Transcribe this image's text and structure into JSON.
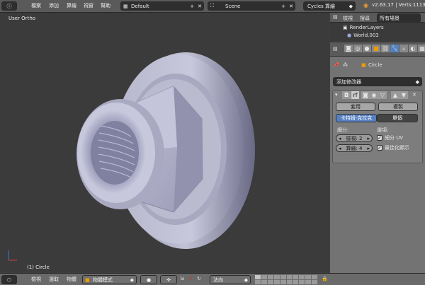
{
  "top": {
    "menus": [
      "檔案",
      "添加",
      "算繪",
      "視窗",
      "幫助"
    ],
    "layout": "Default",
    "scene": "Scene",
    "engine": "Cycles 算繪",
    "version": "v2.63.17 | Verts:1113"
  },
  "viewport": {
    "label": "User Ortho",
    "object_label": "(1) Circle"
  },
  "outliner": {
    "header": [
      "檢視",
      "搜尋",
      "所有場景"
    ],
    "items": [
      "RenderLayers",
      "World.003"
    ]
  },
  "props": {
    "object_name": "Circle",
    "add_modifier": "添加修改器",
    "apply": "套用",
    "copy": "複製",
    "mode_tabs": [
      "卡特姆-克拉克",
      "單個"
    ],
    "subdiv_label": "細分:",
    "options_label": "選項:",
    "view_field": "檢視: 2",
    "render_field": "算繪: 4",
    "opt1": "細分 UV",
    "opt2": "最佳化顯示"
  },
  "bottom": {
    "menus": [
      "檢視",
      "選取",
      "物體"
    ],
    "mode": "物體模式",
    "pivot": "法向"
  },
  "colors": {
    "accent": "#5680c2",
    "nut": "#b9b9d1"
  }
}
